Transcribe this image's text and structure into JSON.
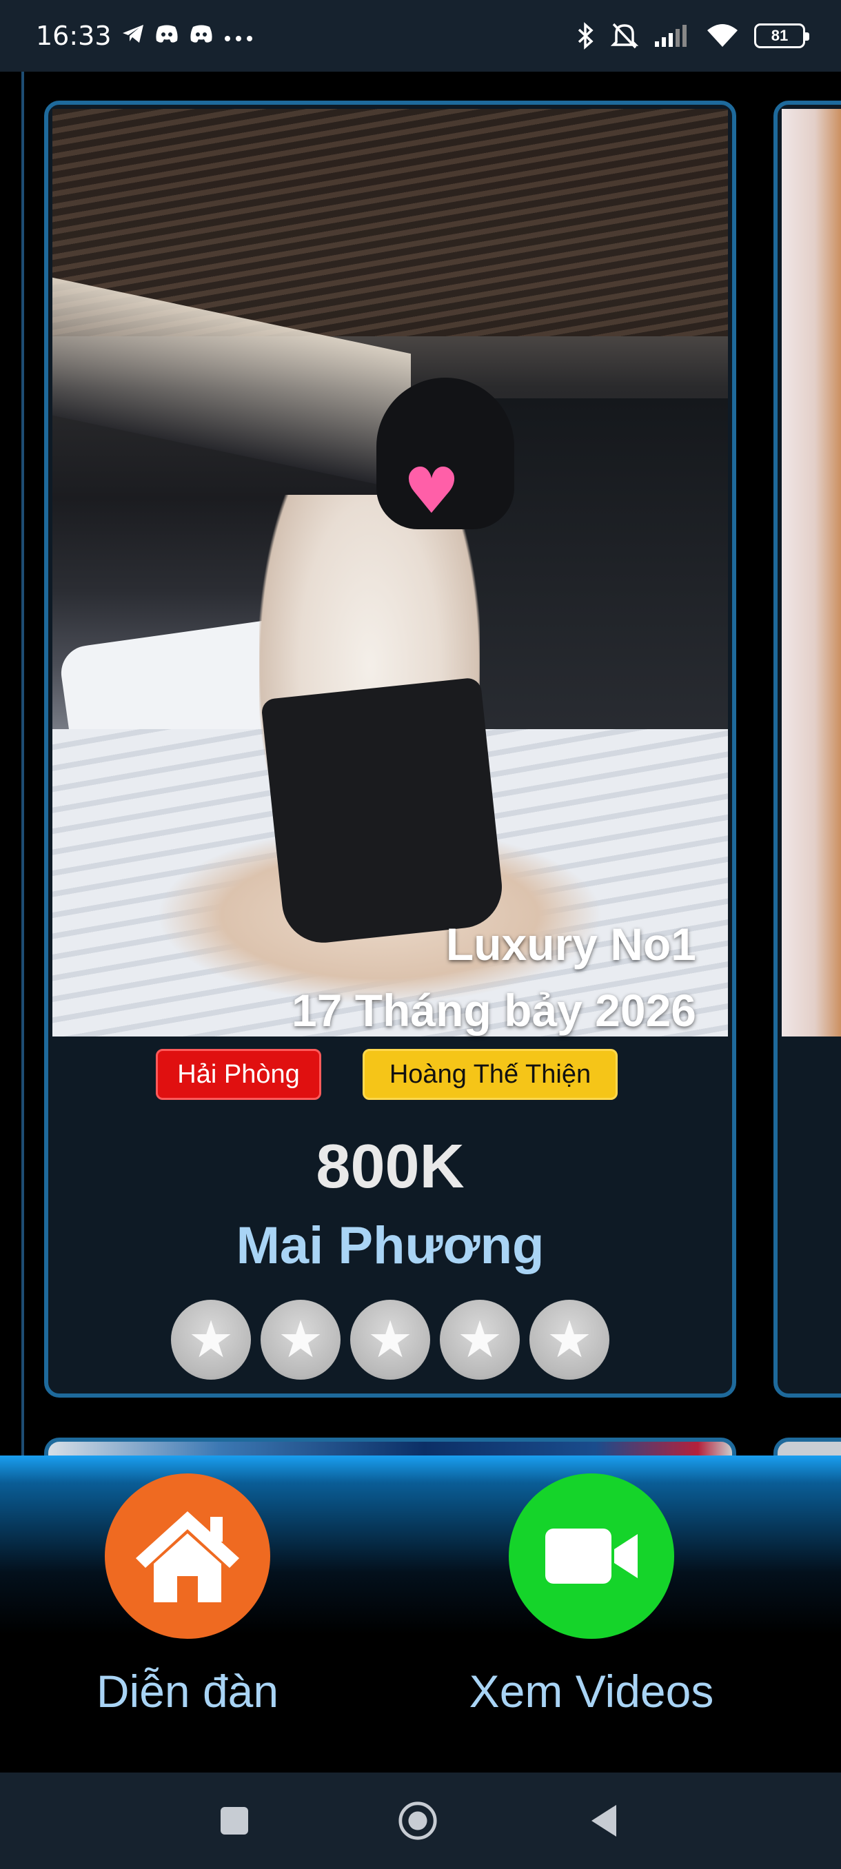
{
  "status_bar": {
    "time": "16:33",
    "left_icons": [
      "telegram-icon",
      "discord-icon",
      "discord-icon",
      "more-icon"
    ],
    "battery": "81"
  },
  "card": {
    "caption_line1": "Luxury No1",
    "caption_line2": "17 Tháng bảy 2026",
    "city_badge": "Hải Phòng",
    "area_badge": "Hoàng Thế Thiện",
    "price": "800K",
    "name": "Mai Phương",
    "rating": 0,
    "stars_total": 5
  },
  "bottom_nav": {
    "home_label": "Diễn đàn",
    "videos_label": "Xem Videos"
  },
  "colors": {
    "accent_border": "#1e6a9c",
    "name_color": "#a9d4f5",
    "city_badge": "#e01010",
    "area_badge": "#f5c518",
    "home_button": "#ef6a21",
    "videos_button": "#15d42a"
  }
}
